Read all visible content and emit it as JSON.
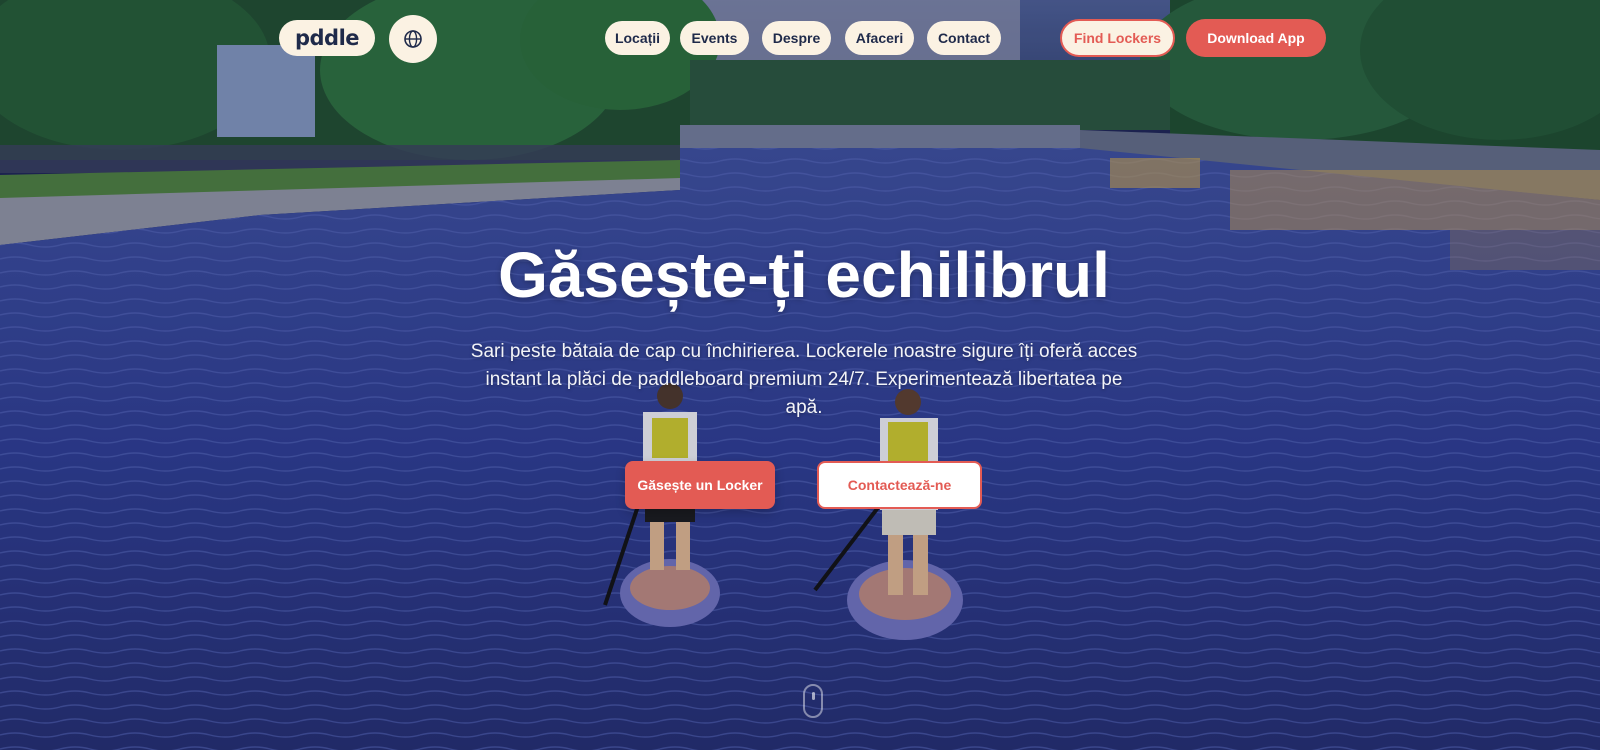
{
  "brand": {
    "logo_text": "pddle"
  },
  "nav": {
    "globe_icon": "globe-icon",
    "items": [
      {
        "label": "Locații"
      },
      {
        "label": "Events"
      },
      {
        "label": "Despre"
      },
      {
        "label": "Afaceri"
      },
      {
        "label": "Contact"
      }
    ],
    "find_lockers_label": "Find Lockers",
    "download_app_label": "Download App"
  },
  "hero": {
    "title": "Găsește-ți echilibrul",
    "subtitle": "Sari peste bătaia de cap cu închirierea. Lockerele noastre sigure îți oferă acces instant la plăci de paddleboard premium 24/7. Experimentează libertatea pe apă.",
    "primary_cta": "Găsește un Locker",
    "secondary_cta": "Contactează-ne"
  },
  "scroll_icon": "scroll-mouse-icon",
  "colors": {
    "accent": "#e35b54",
    "pill_bg": "#fbf2e3",
    "nav_text": "#1f2a4a",
    "water": "#2b3a8a"
  }
}
